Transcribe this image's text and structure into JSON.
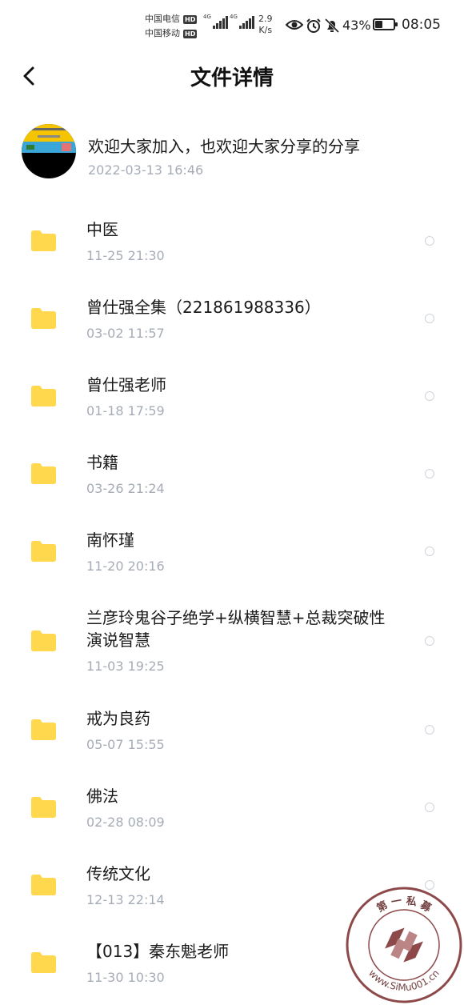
{
  "status_bar": {
    "carrier1": "中国电信",
    "carrier2": "中国移动",
    "hd_label": "HD",
    "net_label": "4G",
    "speed_value": "2.9",
    "speed_unit": "K/s",
    "battery_percent": "43%",
    "battery_level": 0.43,
    "time": "08:05"
  },
  "header": {
    "title": "文件详情"
  },
  "share": {
    "title": "欢迎大家加入，也欢迎大家分享的分享",
    "time": "2022-03-13  16:46"
  },
  "files": [
    {
      "name": "中医",
      "time": "11-25  21:30"
    },
    {
      "name": "曾仕强全集（221861988336）",
      "time": "03-02  11:57"
    },
    {
      "name": "曾仕强老师",
      "time": "01-18  17:59"
    },
    {
      "name": "书籍",
      "time": "03-26  21:24"
    },
    {
      "name": "南怀瑾",
      "time": "11-20  20:16"
    },
    {
      "name": "兰彦玲鬼谷子绝学+纵横智慧+总裁突破性演说智慧",
      "time": "11-03  19:25"
    },
    {
      "name": "戒为良药",
      "time": "05-07  15:55"
    },
    {
      "name": "佛法",
      "time": "02-28  08:09"
    },
    {
      "name": "传统文化",
      "time": "12-13  22:14"
    },
    {
      "name": "【013】秦东魁老师",
      "time": "11-30  10:30"
    }
  ],
  "watermark": {
    "top_text": "第 一 私 募",
    "url_text": "www.SiMu001.cn"
  },
  "colors": {
    "folder": "#ffd84d",
    "secondary_text": "#a6acb6",
    "radio_border": "#cfd3d8"
  }
}
